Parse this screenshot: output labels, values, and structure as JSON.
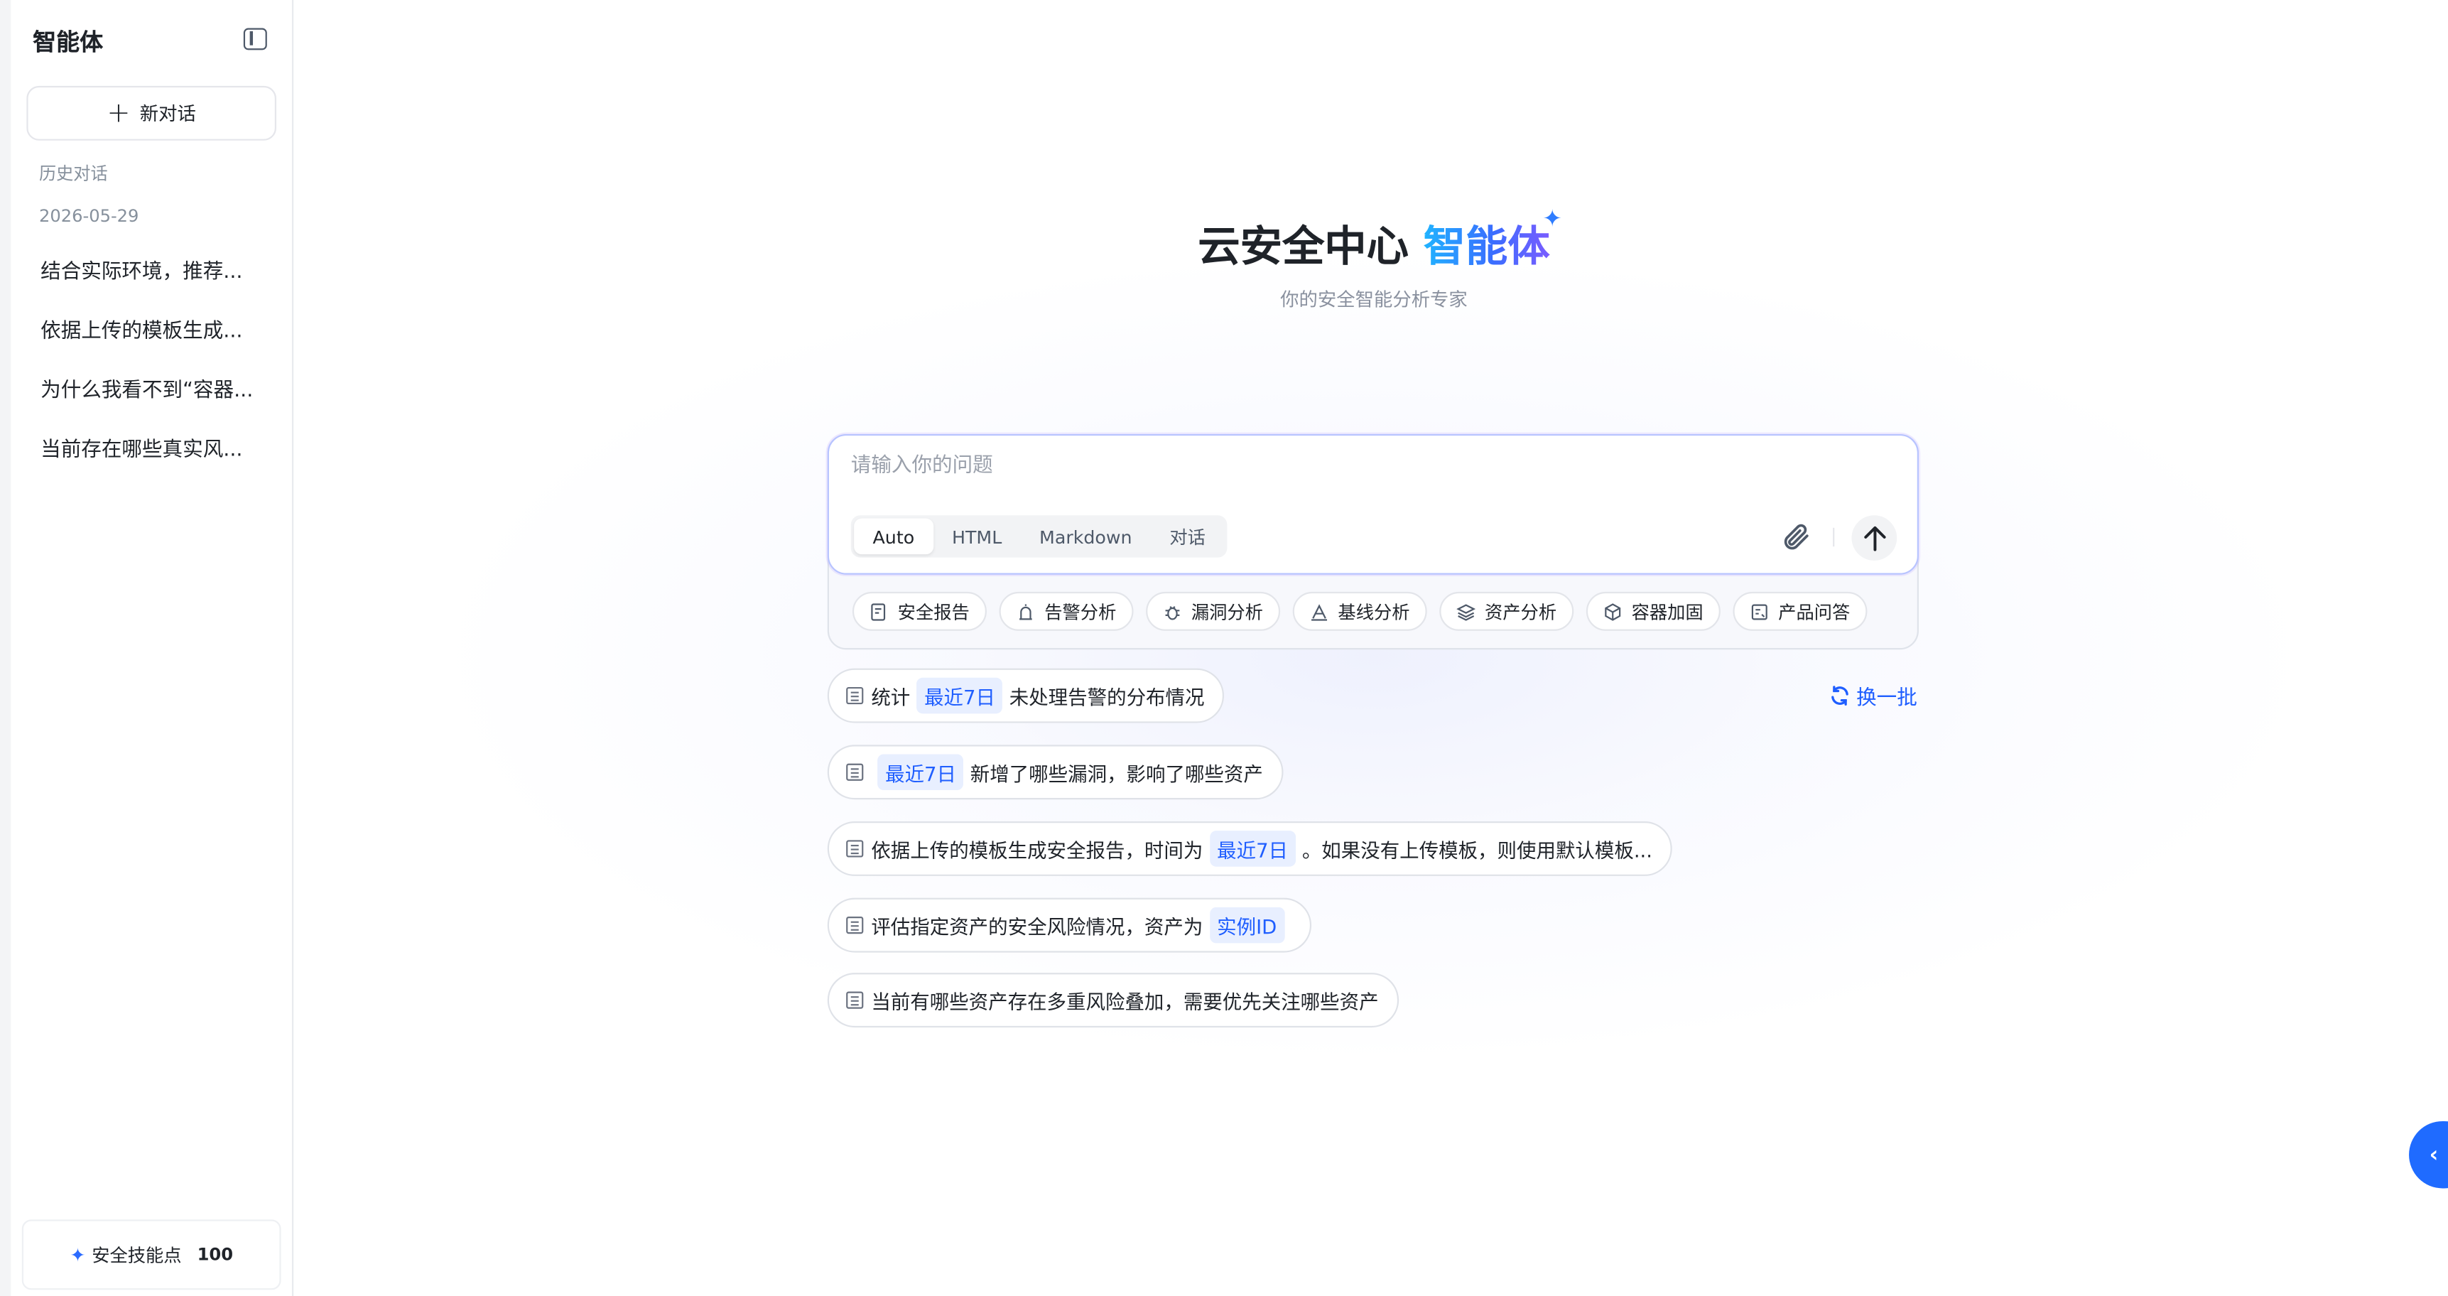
{
  "sidebar": {
    "title": "智能体",
    "new_chat_label": "新对话",
    "history_label": "历史对话",
    "date_label": "2026-05-29",
    "items": [
      {
        "label": "结合实际环境，推荐..."
      },
      {
        "label": "依据上传的模板生成..."
      },
      {
        "label": "为什么我看不到“容器..."
      },
      {
        "label": "当前存在哪些真实风..."
      }
    ],
    "skill_label": "安全技能点",
    "skill_points": "100"
  },
  "hero": {
    "title_prefix": "云安全中心",
    "title_highlight": "智能体",
    "subtitle": "你的安全智能分析专家"
  },
  "composer": {
    "placeholder": "请输入你的问题",
    "modes": [
      {
        "label": "Auto",
        "active": true
      },
      {
        "label": "HTML"
      },
      {
        "label": "Markdown"
      },
      {
        "label": "对话"
      }
    ]
  },
  "chips": [
    {
      "label": "安全报告",
      "icon": "report-edit-icon"
    },
    {
      "label": "告警分析",
      "icon": "alarm-icon"
    },
    {
      "label": "漏洞分析",
      "icon": "bug-icon"
    },
    {
      "label": "基线分析",
      "icon": "baseline-icon"
    },
    {
      "label": "资产分析",
      "icon": "layers-icon"
    },
    {
      "label": "容器加固",
      "icon": "container-icon"
    },
    {
      "label": "产品问答",
      "icon": "qa-icon"
    }
  ],
  "refresh_label": "换一批",
  "suggestions": {
    "s1": {
      "before": "统计",
      "tag": "最近7日",
      "after": "未处理告警的分布情况"
    },
    "s2": {
      "tag": "最近7日",
      "after": "新增了哪些漏洞，影响了哪些资产"
    },
    "s3": {
      "before": "依据上传的模板生成安全报告，时间为",
      "tag": "最近7日",
      "after": "。如果没有上传模板，则使用默认模板..."
    },
    "s4": {
      "before": "评估指定资产的安全风险情况，资产为",
      "tag": "实例ID"
    },
    "s5": {
      "before": "当前有哪些资产存在多重风险叠加，需要优先关注哪些资产"
    }
  },
  "colors": {
    "accent": "#1f5eff",
    "tag_bg": "#e8efff",
    "fab": "#1f6bff"
  }
}
